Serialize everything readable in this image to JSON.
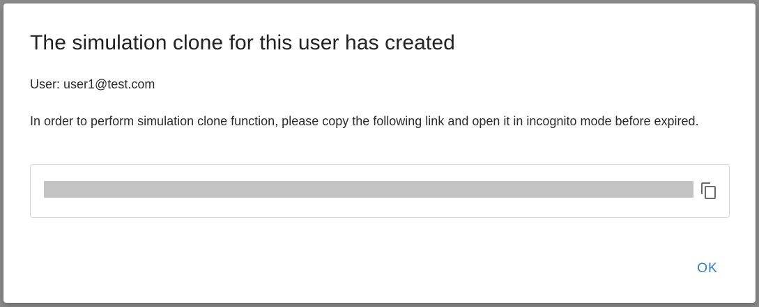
{
  "dialog": {
    "title": "The simulation clone for this user has created",
    "user_line": "User: user1@test.com",
    "instructions": "In order to perform simulation clone function, please copy the following link and open it in incognito mode before expired.",
    "link_field": {
      "value": "",
      "redacted": true,
      "copy_icon": "copy-icon"
    },
    "ok_label": "OK"
  },
  "colors": {
    "accent": "#2f80d6",
    "text": "#2b2b2b",
    "redaction": "#c3c3c3",
    "field_border": "#d6d6d6"
  }
}
